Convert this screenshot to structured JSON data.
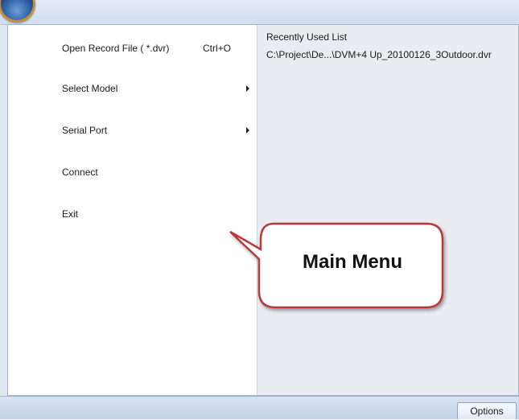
{
  "app": {
    "orb_icon": "application-orb-icon"
  },
  "menu": {
    "items": [
      {
        "label": "Open Record File ( *.dvr)",
        "shortcut": "Ctrl+O",
        "has_submenu": false
      },
      {
        "label": "Select Model",
        "shortcut": "",
        "has_submenu": true
      },
      {
        "label": "Serial Port",
        "shortcut": "",
        "has_submenu": true
      },
      {
        "label": "Connect",
        "shortcut": "",
        "has_submenu": false
      },
      {
        "label": "Exit",
        "shortcut": "",
        "has_submenu": false
      }
    ]
  },
  "recent": {
    "title": "Recently Used List",
    "files": [
      "C:\\Project\\De...\\DVM+4 Up_20100126_3Outdoor.dvr"
    ]
  },
  "footer": {
    "options_label": "Options"
  },
  "annotation": {
    "callout_text": "Main Menu",
    "callout_border_color": "#b83a3a"
  }
}
